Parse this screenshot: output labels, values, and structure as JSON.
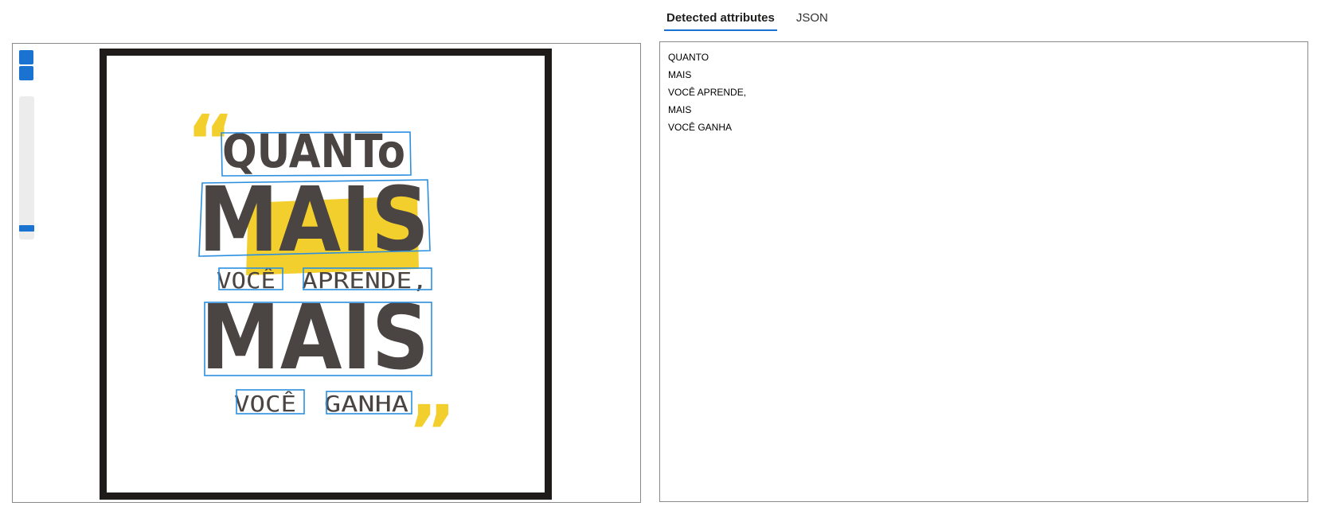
{
  "tabs": [
    {
      "label": "Detected attributes",
      "active": true
    },
    {
      "label": "JSON",
      "active": false
    }
  ],
  "detected_lines": [
    "QUANTO",
    "MAIS",
    "VOCÊ APRENDE,",
    "MAIS",
    "VOCÊ GANHA"
  ],
  "image": {
    "words": [
      "QUANTo",
      "MAIS",
      "VOCÊ",
      "APRENDE,",
      "MAIS",
      "VOCÊ",
      "GANHA"
    ],
    "quote_open": "“",
    "quote_close": "”"
  },
  "colors": {
    "accent": "#1a73d0",
    "bbox": "#2b8fe0",
    "ink": "#4a4442",
    "highlight": "#f3cf2d",
    "frame": "#1f1b1a"
  }
}
